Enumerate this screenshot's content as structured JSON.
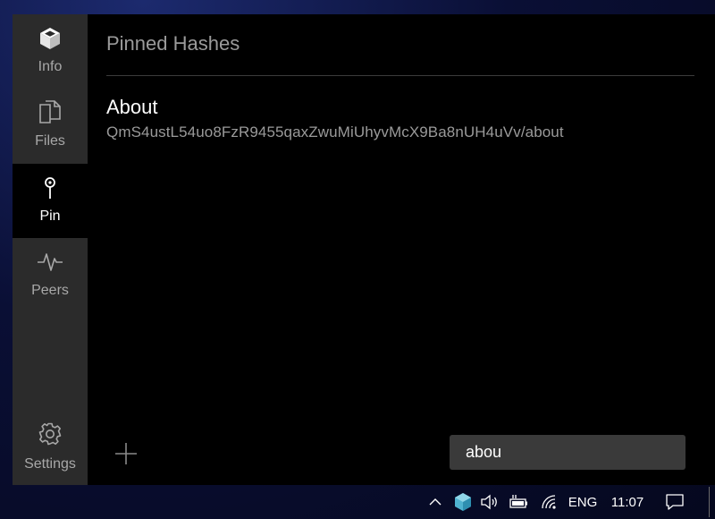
{
  "sidebar": {
    "items": [
      {
        "label": "Info",
        "icon": "cube-icon"
      },
      {
        "label": "Files",
        "icon": "files-icon"
      },
      {
        "label": "Pin",
        "icon": "pin-icon",
        "active": true
      },
      {
        "label": "Peers",
        "icon": "pulse-icon"
      }
    ],
    "settings_label": "Settings"
  },
  "main": {
    "title": "Pinned Hashes",
    "pinned": [
      {
        "name": "About",
        "hash": "QmS4ustL54uo8FzR9455qaxZwuMiUhyvMcX9Ba8nUH4uVv/about"
      }
    ],
    "search": {
      "value": "abou"
    }
  },
  "taskbar": {
    "language": "ENG",
    "time": "11:07"
  },
  "colors": {
    "sidebar_bg": "#2b2b2b",
    "content_bg": "#000000",
    "search_bg": "#3a3a3a",
    "tray_accent": "#4fb3d0"
  }
}
